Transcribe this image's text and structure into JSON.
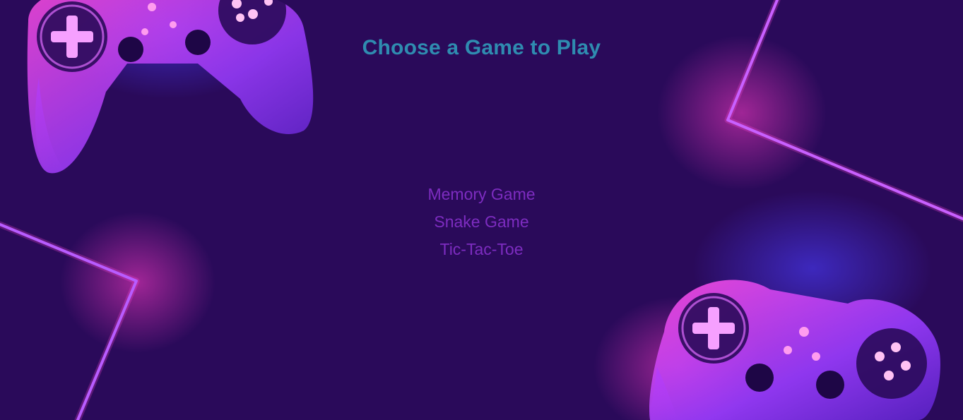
{
  "page": {
    "title": "Choose a Game to Play"
  },
  "games": [
    {
      "label": "Memory Game"
    },
    {
      "label": "Snake Game"
    },
    {
      "label": "Tic-Tac-Toe"
    }
  ],
  "colors": {
    "background": "#2a0a5a",
    "title": "#2f8cb0",
    "link": "#7d2cc0",
    "neon_pink": "#ff3cc7",
    "neon_purple": "#8a3cff"
  },
  "background_art": {
    "icons": [
      "gamepad-icon",
      "neon-line-icon"
    ]
  }
}
